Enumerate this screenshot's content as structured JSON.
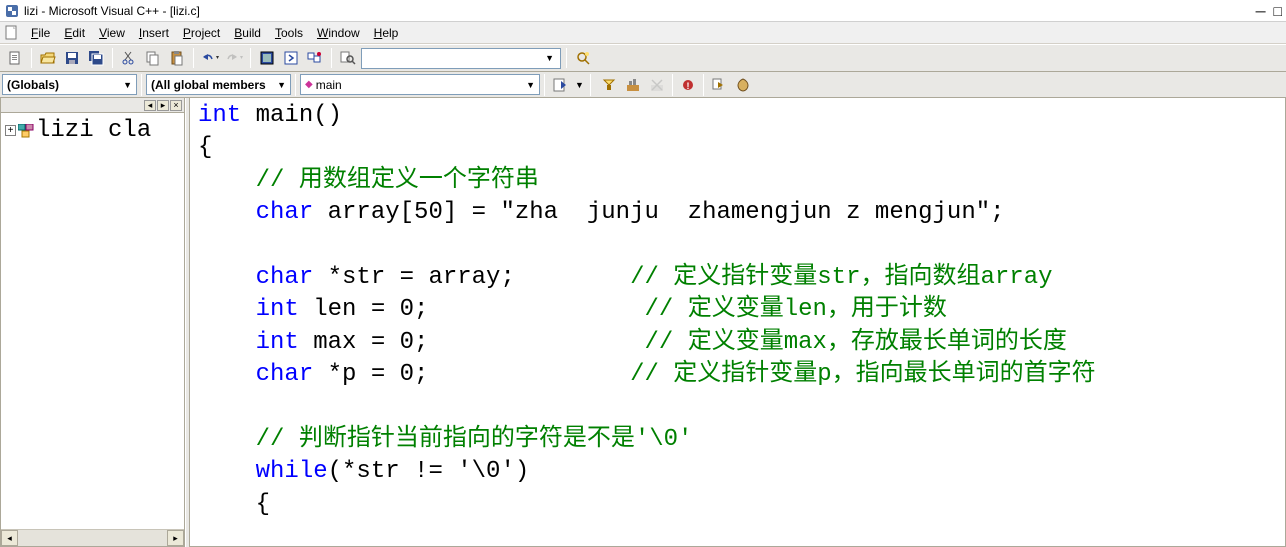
{
  "title": "lizi - Microsoft Visual C++ - [lizi.c]",
  "menu": {
    "file": "File",
    "edit": "Edit",
    "view": "View",
    "insert": "Insert",
    "project": "Project",
    "build": "Build",
    "tools": "Tools",
    "window": "Window",
    "help": "Help"
  },
  "combos": {
    "globals": "(Globals)",
    "members": "(All global members",
    "main": "main"
  },
  "tree": {
    "root": "lizi cla"
  },
  "code": {
    "l1_kw": "int",
    "l1_rest": " main()",
    "l2": "{",
    "l3_cmt": "// 用数组定义一个字符串",
    "l4_kw": "char",
    "l4_rest": " array[50] = \"zha  junju  zhamengjun z mengjun\";",
    "l5_kw": "char",
    "l5_rest": " *str = array;",
    "l5_cmt": "// 定义指针变量str，指向数组array",
    "l6_kw": "int",
    "l6_rest": " len = 0;",
    "l6_cmt": "// 定义变量len，用于计数",
    "l7_kw": "int",
    "l7_rest": " max = 0;",
    "l7_cmt": "// 定义变量max，存放最长单词的长度",
    "l8_kw": "char",
    "l8_rest": " *p = 0;",
    "l8_cmt": "// 定义指针变量p，指向最长单词的首字符",
    "l9_cmt": "// 判断指针当前指向的字符是不是'\\0'",
    "l10_kw": "while",
    "l10_rest": "(*str != '\\0')",
    "l11": "{"
  }
}
